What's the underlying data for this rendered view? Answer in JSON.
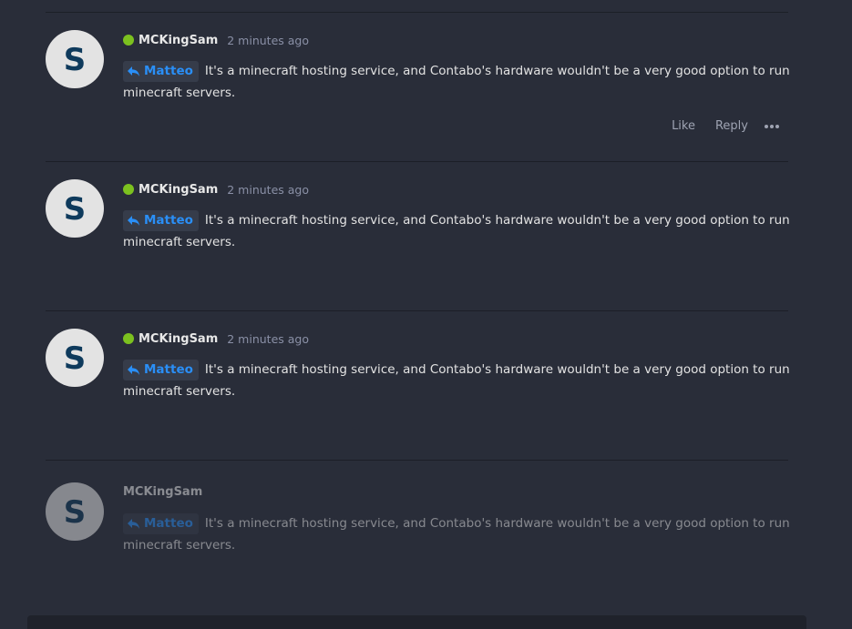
{
  "comments": [
    {
      "avatar_letter": "S",
      "username": "MCKingSam",
      "online": true,
      "time": "2 minutes ago",
      "quote_user": "Matteo",
      "text": "It's a minecraft hosting service, and Contabo's hardware wouldn't be a very good option to run minecraft servers.",
      "actions": {
        "like": "Like",
        "reply": "Reply"
      }
    },
    {
      "avatar_letter": "S",
      "username": "MCKingSam",
      "online": true,
      "time": "2 minutes ago",
      "quote_user": "Matteo",
      "text": "It's a minecraft hosting service, and Contabo's hardware wouldn't be a very good option to run minecraft servers."
    },
    {
      "avatar_letter": "S",
      "username": "MCKingSam",
      "online": true,
      "time": "2 minutes ago",
      "quote_user": "Matteo",
      "text": "It's a minecraft hosting service, and Contabo's hardware wouldn't be a very good option to run minecraft servers."
    },
    {
      "avatar_letter": "S",
      "username": "MCKingSam",
      "online": false,
      "quote_user": "Matteo",
      "text": "It's a minecraft hosting service, and Contabo's hardware wouldn't be a very good option to run minecraft servers."
    }
  ],
  "colors": {
    "background": "#292d39",
    "online": "#7cc11f",
    "quote_link": "#2a8ff7"
  },
  "icons": {
    "reply": "reply-arrow-icon",
    "more": "ellipsis-icon"
  }
}
